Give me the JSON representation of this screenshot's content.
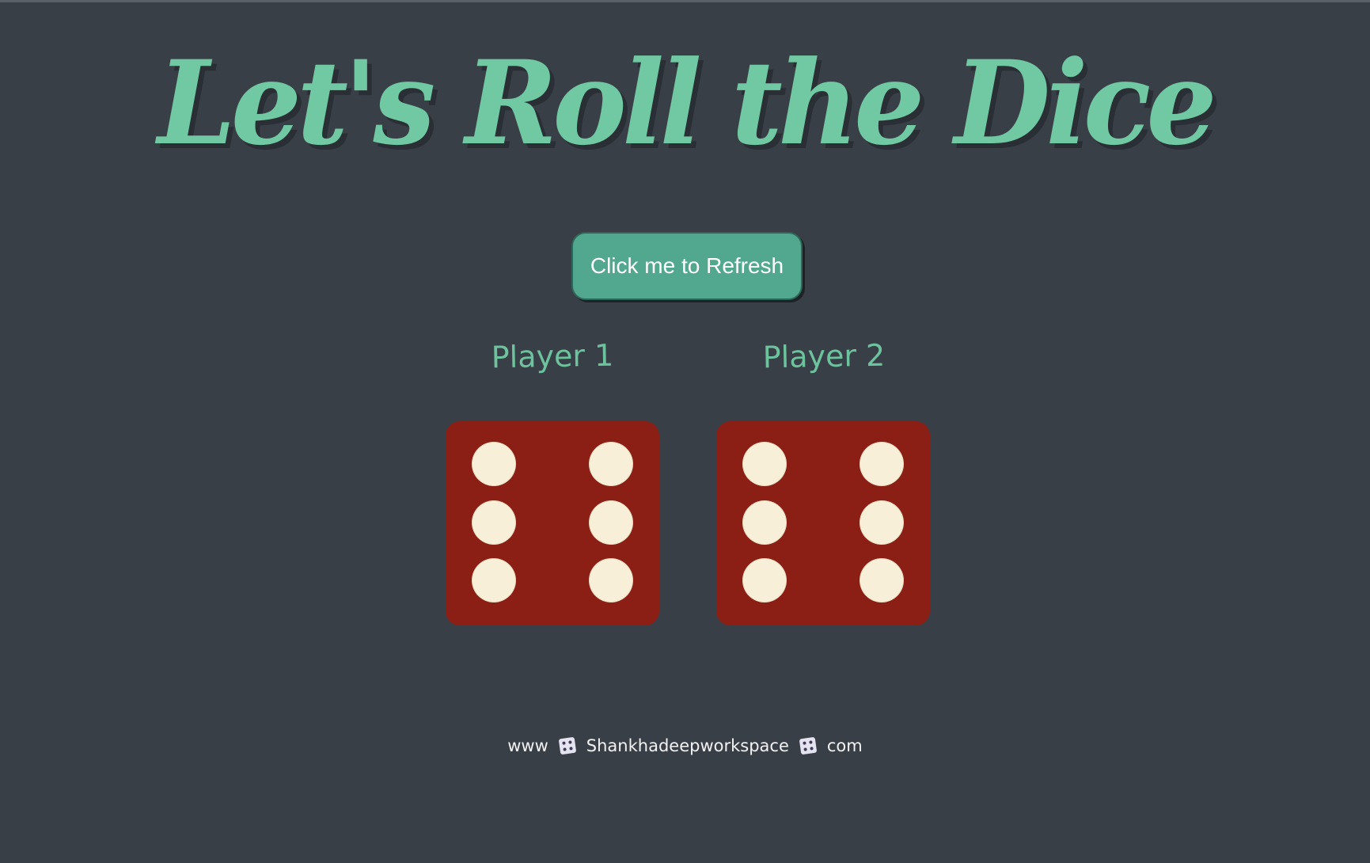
{
  "page": {
    "title": "Let's Roll the Dice"
  },
  "controls": {
    "refresh_label": "Click me to Refresh"
  },
  "players": [
    {
      "label": "Player 1",
      "die_value": 6
    },
    {
      "label": "Player 2",
      "die_value": 6
    }
  ],
  "footer": {
    "prefix": "www",
    "name": "Shankhadeepworkspace",
    "suffix": "com",
    "separator_icon": "dice-icon"
  },
  "colors": {
    "background": "#393f47",
    "accent": "#70c9a2",
    "button": "#52a88e",
    "die_face": "#8b1f15",
    "pip": "#f8efd8"
  }
}
